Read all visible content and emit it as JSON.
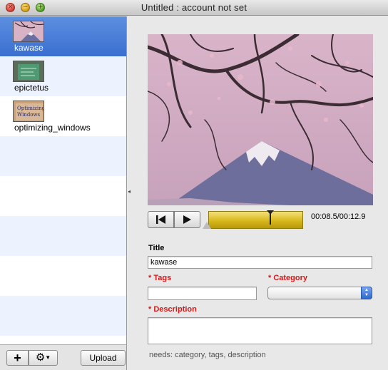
{
  "window": {
    "title": "Untitled : account not set",
    "close_glyph": "×",
    "minimize_glyph": "−",
    "zoom_glyph": "+"
  },
  "sidebar": {
    "items": [
      {
        "label": "kawase",
        "selected": true
      },
      {
        "label": "epictetus",
        "selected": false
      },
      {
        "label": "optimizing_windows",
        "selected": false
      }
    ],
    "add_button": "+",
    "gear_button": "⚙",
    "upload_button": "Upload",
    "splitter_glyph": "◂"
  },
  "player": {
    "time": "00:08.5/00:12.9",
    "progress": 0.66,
    "rewind_icon": "skip-to-start-icon",
    "play_icon": "play-icon"
  },
  "form": {
    "title_label": "Title",
    "title_value": "kawase",
    "tags_label": "* Tags",
    "tags_value": "",
    "category_label": "* Category",
    "category_value": "",
    "description_label": "* Description",
    "description_value": "",
    "status": "needs: category, tags, description"
  },
  "colors": {
    "selection": "#3a6fd0",
    "required": "#d11a1a",
    "scrubber": "#d8b81c"
  }
}
